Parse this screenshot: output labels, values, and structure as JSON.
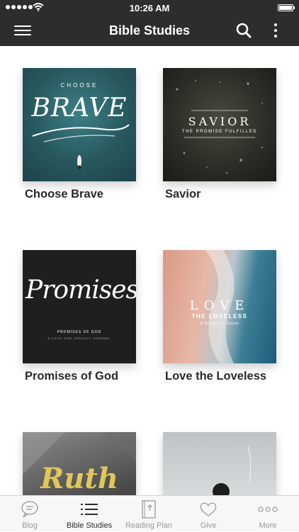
{
  "status_bar": {
    "time": "10:26 AM"
  },
  "header": {
    "title": "Bible Studies"
  },
  "studies": [
    {
      "title": "Choose Brave",
      "cover_text": [
        "CHOOSE",
        "BRAVE"
      ]
    },
    {
      "title": "Savior",
      "cover_text": [
        "SAVIOR",
        "THE PROMISE FULFILLED"
      ]
    },
    {
      "title": "Promises of God",
      "cover_text": [
        "Promises",
        "PROMISES OF GOD",
        "A LOVE GOD GREATLY JOURNAL"
      ]
    },
    {
      "title": "Love the Loveless",
      "cover_text": [
        "LOVE",
        "THE LOVELESS",
        "A Study on Jonah"
      ]
    },
    {
      "title": "",
      "cover_text": [
        "Ruth"
      ]
    },
    {
      "title": "",
      "cover_text": []
    }
  ],
  "tabs": [
    {
      "label": "Blog",
      "icon": "chat-bubble-icon",
      "active": false
    },
    {
      "label": "Bible Studies",
      "icon": "list-icon",
      "active": true
    },
    {
      "label": "Reading Plan",
      "icon": "bible-book-icon",
      "active": false
    },
    {
      "label": "Give",
      "icon": "heart-icon",
      "active": false
    },
    {
      "label": "More",
      "icon": "more-dots-icon",
      "active": false
    }
  ],
  "colors": {
    "header_bg": "#2d2d2d",
    "tab_bar_bg": "#f7f7f7",
    "tab_active": "#2d2d2d",
    "tab_inactive": "#999999"
  }
}
